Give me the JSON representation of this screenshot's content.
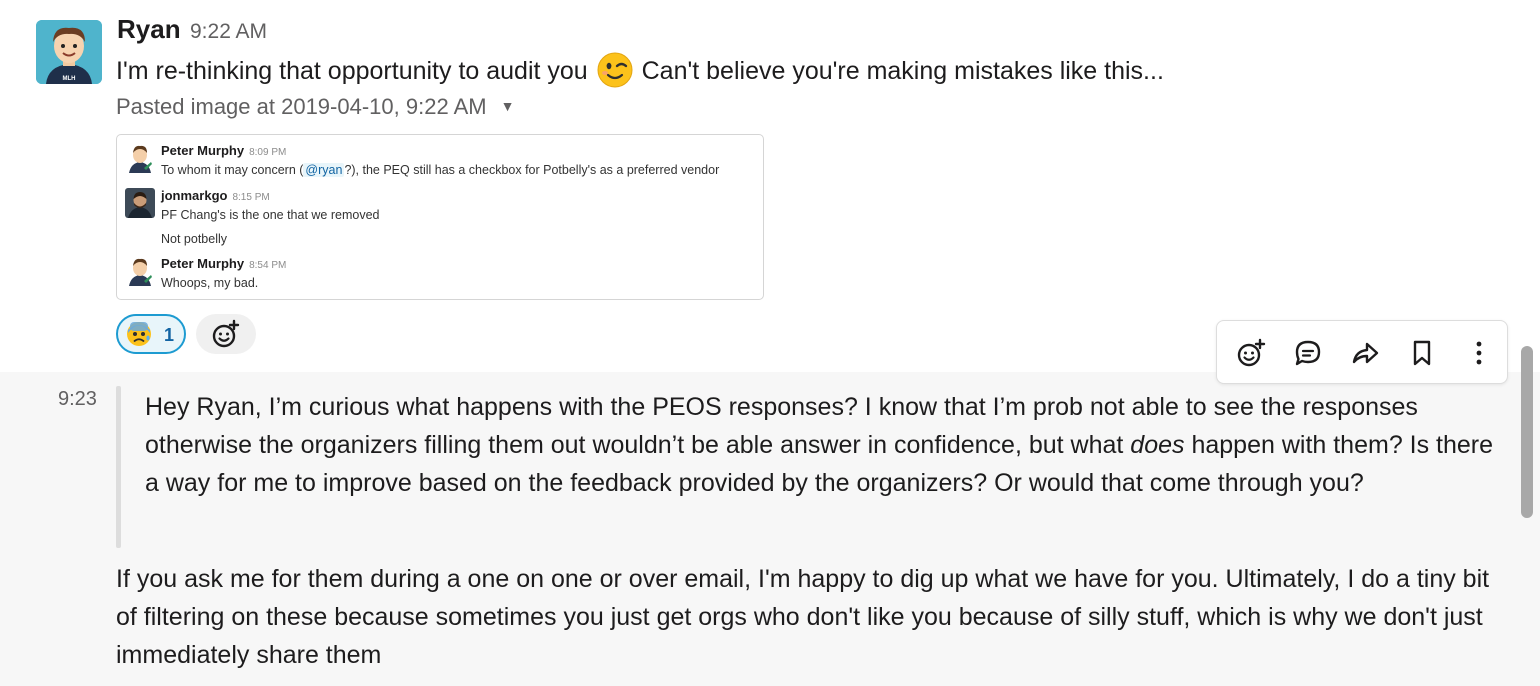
{
  "message1": {
    "author": "Ryan",
    "time": "9:22 AM",
    "text_before_emoji": "I'm re-thinking that opportunity to audit you",
    "emoji": "wink-emoji",
    "text_after_emoji": "Can't believe you're making mistakes like this...",
    "attachment_title": "Pasted image at 2019-04-10, 9:22 AM",
    "pasted_image": {
      "messages": [
        {
          "name": "Peter Murphy",
          "time": "8:09 PM",
          "pre": "To whom it may concern (",
          "mention": "@ryan",
          "post": "?), the PEQ still has a checkbox for Potbelly's as a preferred vendor"
        },
        {
          "name": "jonmarkgo",
          "time": "8:15 PM",
          "line1": "PF Chang's is the one that we removed",
          "line2": "Not potbelly"
        },
        {
          "name": "Peter Murphy",
          "time": "8:54 PM",
          "line1": "Whoops, my bad."
        }
      ]
    },
    "reaction": {
      "emoji": "anxious-face-emoji",
      "count": "1"
    }
  },
  "message2": {
    "time": "9:23",
    "quote_before": "Hey Ryan, I’m curious what happens with the PEOS responses?  I know that I’m prob not able to see the responses otherwise the organizers filling them out wouldn’t be able answer in confidence, but what ",
    "quote_emph": "does",
    "quote_after": " happen with them? Is there a way for me to improve based on the feedback provided by the organizers? Or would that come through you?",
    "reply": "If you ask me for them during a one on one or over email, I'm happy to dig up what we have for you. Ultimately, I do a tiny bit of filtering on these because sometimes you just get orgs who don't like you because of silly stuff, which is why we don't just immediately share them"
  },
  "actions": [
    "add-reaction-icon",
    "reply-in-thread-icon",
    "share-message-icon",
    "save-bookmark-icon",
    "more-actions-icon"
  ]
}
